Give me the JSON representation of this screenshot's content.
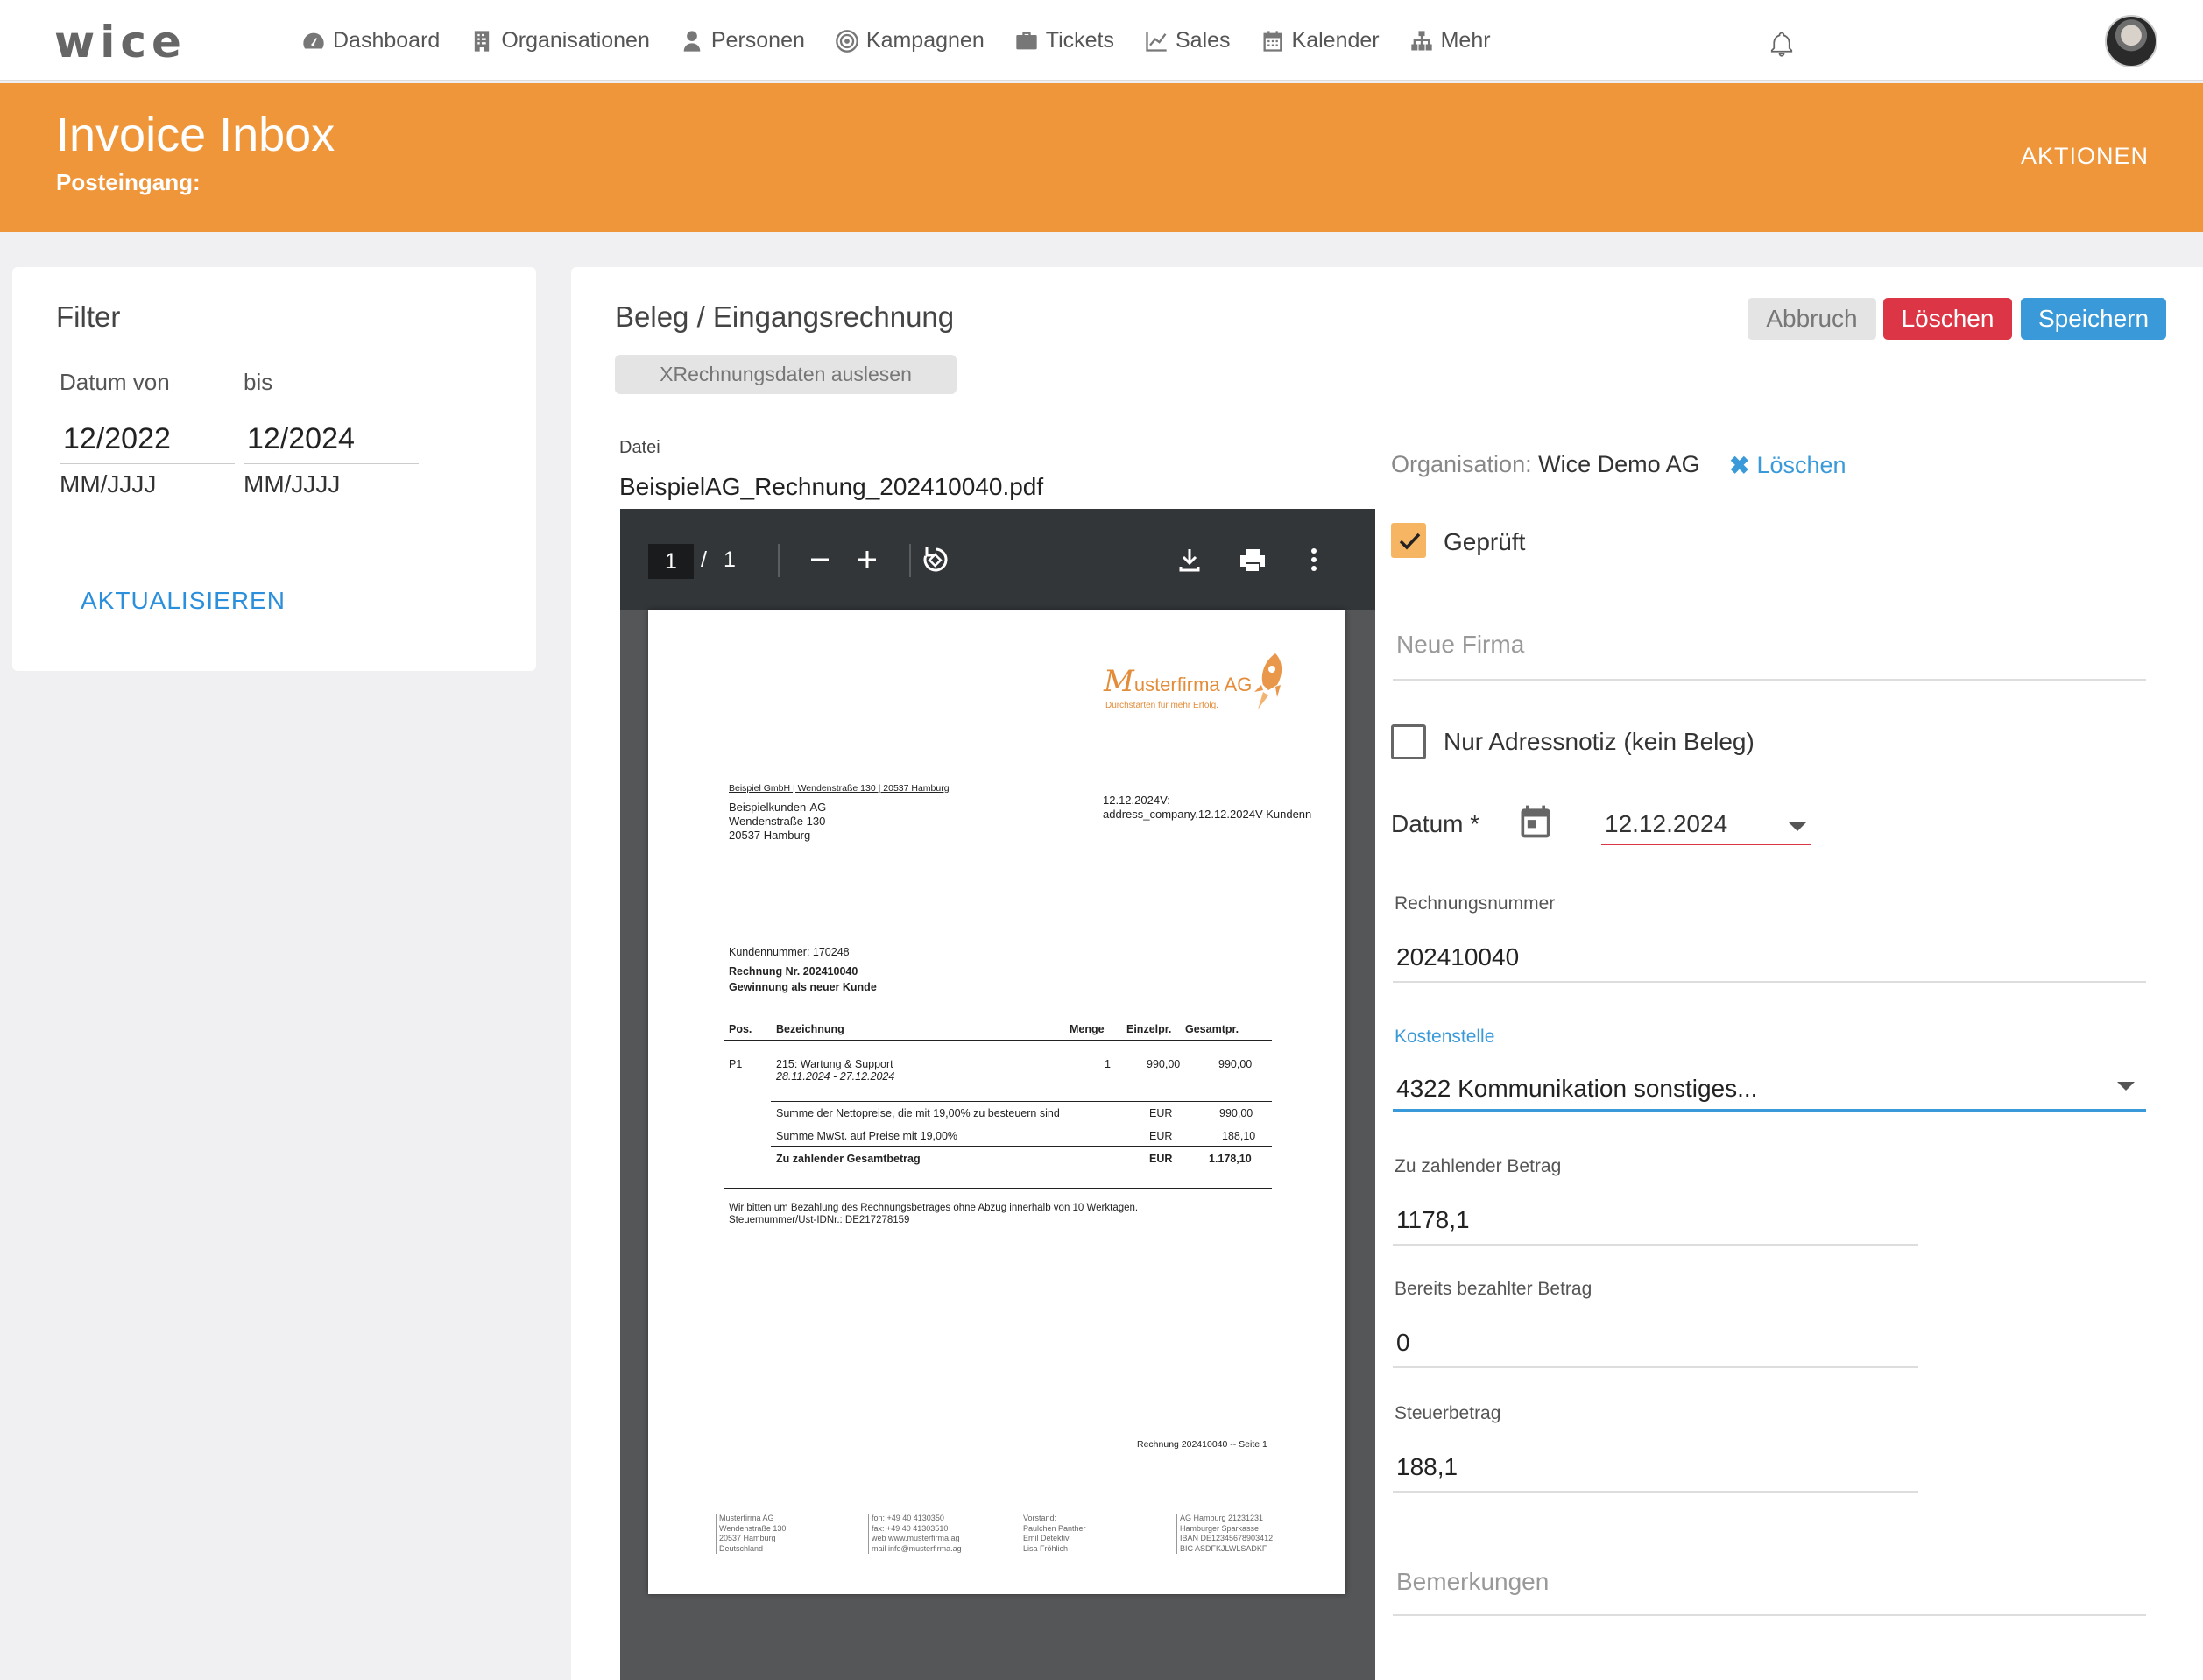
{
  "nav": {
    "logo": "wice",
    "items": [
      {
        "label": "Dashboard",
        "icon": "dashboard-icon"
      },
      {
        "label": "Organisationen",
        "icon": "building-icon"
      },
      {
        "label": "Personen",
        "icon": "person-icon"
      },
      {
        "label": "Kampagnen",
        "icon": "target-icon"
      },
      {
        "label": "Tickets",
        "icon": "briefcase-icon"
      },
      {
        "label": "Sales",
        "icon": "chart-line-icon"
      },
      {
        "label": "Kalender",
        "icon": "calendar-icon"
      },
      {
        "label": "Mehr",
        "icon": "sitemap-icon"
      }
    ],
    "bell_icon": "bell-icon",
    "avatar_icon": "user-avatar"
  },
  "header": {
    "title": "Invoice Inbox",
    "subtitle": "Posteingang:",
    "actions": "AKTIONEN",
    "color": "#f0963a"
  },
  "filter": {
    "title": "Filter",
    "from_label": "Datum von",
    "to_label": "bis",
    "from_value": "12/2022",
    "to_value": "12/2024",
    "from_hint": "MM/JJJJ",
    "to_hint": "MM/JJJJ",
    "refresh": "AKTUALISIEREN"
  },
  "main": {
    "title": "Beleg / Eingangsrechnung",
    "xrechnung_button": "XRechnungsdaten auslesen",
    "cancel_button": "Abbruch",
    "delete_button": "Löschen",
    "save_button": "Speichern",
    "file_label": "Datei",
    "file_name": "BeispielAG_Rechnung_202410040.pdf"
  },
  "pdf_viewer": {
    "page_current": "1",
    "page_separator": "/",
    "page_total": "1",
    "doc": {
      "logo_initial": "M",
      "logo_rest": "usterfirma AG",
      "logo_slogan": "Durchstarten für mehr Erfolg.",
      "sender_line": "Beispiel GmbH |  Wendenstraße 130 | 20537 Hamburg",
      "recipient": [
        "Beispielkunden-AG",
        "Wendenstraße 130",
        "20537 Hamburg"
      ],
      "date_line1": "12.12.2024V:",
      "date_line2": "address_company.12.12.2024V-Kundenn",
      "customer_no": "Kundennummer: 170248",
      "invoice_no": "Rechnung Nr. 202410040",
      "subject": "Gewinnung als neuer Kunde",
      "col_pos": "Pos.",
      "col_desc": "Bezeichnung",
      "col_qty": "Menge",
      "col_unit": "Einzelpr.",
      "col_total": "Gesamtpr.",
      "item_pos": "P1",
      "item_desc": "215: Wartung & Support",
      "item_period": "28.11.2024 - 27.12.2024",
      "item_qty": "1",
      "item_unit": "990,00",
      "item_total": "990,00",
      "sum_net_label": "Summe der Nettopreise, die mit 19,00% zu besteuern sind",
      "sum_net_cur": "EUR",
      "sum_net_val": "990,00",
      "sum_vat_label": "Summe MwSt. auf Preise mit 19,00%",
      "sum_vat_cur": "EUR",
      "sum_vat_val": "188,10",
      "sum_total_label": "Zu zahlender Gesamtbetrag",
      "sum_total_cur": "EUR",
      "sum_total_val": "1.178,10",
      "note1": "Wir bitten um Bezahlung des Rechnungsbetrages ohne Abzug innerhalb von 10 Werktagen.",
      "note2": "Steuernummer/Ust-IDNr.: DE217278159",
      "page_footer": "Rechnung 202410040 -- Seite 1",
      "footer_cols": [
        [
          "Musterfirma AG",
          "Wendenstraße 130",
          "20537 Hamburg",
          "Deutschland"
        ],
        [
          "fon: +49 40 4130350",
          "fax:  +49 40 41303510",
          "web www.musterfirma.ag",
          "mail info@musterfirma.ag"
        ],
        [
          "Vorstand:",
          "Paulchen Panther",
          "Emil Detektiv",
          "Lisa Fröhlich"
        ],
        [
          "AG Hamburg 21231231",
          "Hamburger Sparkasse",
          "IBAN DE12345678903412",
          "BIC ASDFKJLWLSADKF"
        ]
      ]
    }
  },
  "form": {
    "org_label": "Organisation: ",
    "org_value": "Wice Demo AG",
    "org_delete": "Löschen",
    "checked_label": "Geprüft",
    "checked": true,
    "new_company_placeholder": "Neue Firma",
    "address_note_label": "Nur Adressnotiz (kein Beleg)",
    "address_note_checked": false,
    "date_label": "Datum *",
    "date_value": "12.12.2024",
    "invoice_no_label": "Rechnungsnummer",
    "invoice_no_value": "202410040",
    "cost_center_label": "Kostenstelle",
    "cost_center_value": "4322 Kommunikation sonstiges...",
    "amount_label": "Zu zahlender Betrag",
    "amount_value": "1178,1",
    "paid_label": "Bereits bezahlter Betrag",
    "paid_value": "0",
    "tax_label": "Steuerbetrag",
    "tax_value": "188,1",
    "remarks_placeholder": "Bemerkungen"
  }
}
